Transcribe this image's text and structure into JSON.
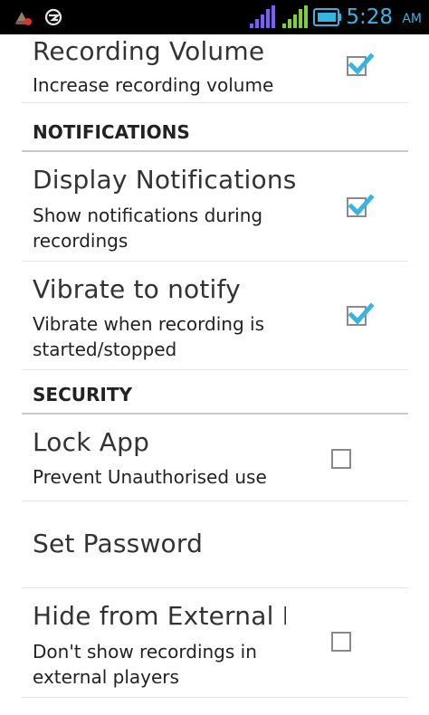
{
  "status_bar": {
    "time": "5:28",
    "ampm": "AM",
    "icons": [
      "app-notification-icon",
      "sync-icon",
      "signal-sim1-icon",
      "signal-sim2-icon",
      "battery-icon"
    ]
  },
  "preferences": [
    {
      "title": "Recording Volume",
      "summary": "Increase recording volume",
      "checked": true
    },
    {
      "category": "NOTIFICATIONS"
    },
    {
      "title": "Display Notifications",
      "summary": "Show notifications during recordings",
      "checked": true
    },
    {
      "title": "Vibrate to notify",
      "summary": "Vibrate when recording is started/stopped",
      "checked": true
    },
    {
      "category": "SECURITY"
    },
    {
      "title": "Lock App",
      "summary": "Prevent Unauthorised use",
      "checked": false
    },
    {
      "title": "Set Password"
    },
    {
      "title": "Hide from External P",
      "summary": "Don't show recordings in external players",
      "checked": false
    }
  ],
  "colors": {
    "accent": "#33b5e5",
    "signal_sim1": "#7b5cff",
    "signal_sim2": "#7ad13b"
  }
}
